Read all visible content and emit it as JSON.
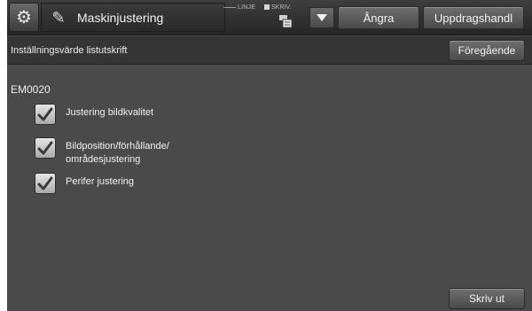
{
  "header": {
    "title": "Maskinjustering",
    "line_indicator": "LINJE",
    "print_indicator": "SKRIV.",
    "undo_label": "Ångra",
    "jobs_label": "Uppdragshandl"
  },
  "subheader": {
    "title": "Inställningsvärde listutskrift",
    "previous_label": "Föregående"
  },
  "content": {
    "section_code": "EM0020",
    "options": [
      {
        "label": "Justering bildkvalitet",
        "checked": true
      },
      {
        "label": "Bildposition/förhållande/\nområdesjustering",
        "checked": true
      },
      {
        "label": "Perifer justering",
        "checked": true
      }
    ]
  },
  "footer": {
    "print_label": "Skriv ut"
  }
}
